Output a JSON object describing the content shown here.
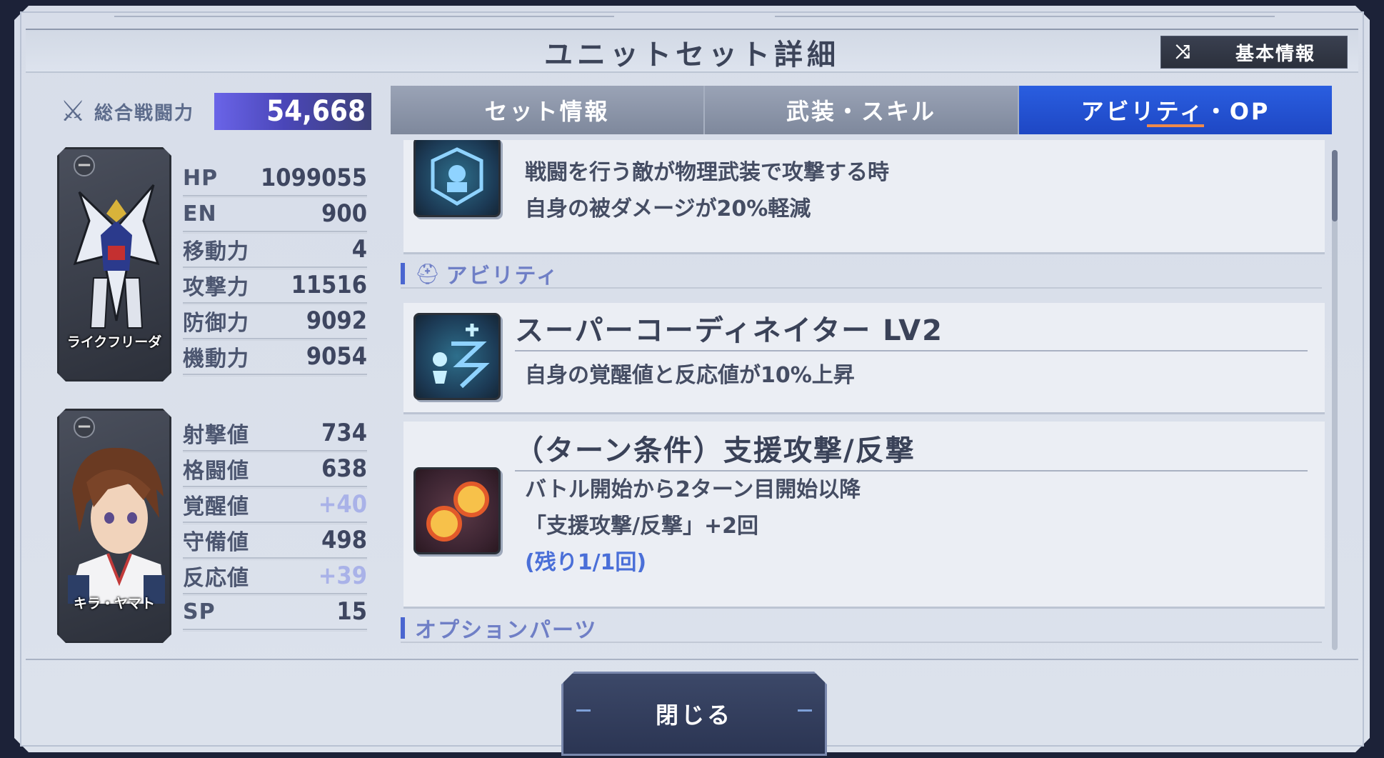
{
  "header": {
    "title": "ユニットセット詳細",
    "basic_info_label": "基本情報",
    "basic_info_icon": "shuffle-icon"
  },
  "power": {
    "label": "総合戦闘力",
    "value": "54,668",
    "icon": "crossed-swords-icon"
  },
  "unit_card": {
    "caption": "ライクフリーダ"
  },
  "pilot_card": {
    "caption": "キラ・ヤマト"
  },
  "unit_stats": [
    {
      "label": "HP",
      "value": "1099055"
    },
    {
      "label": "EN",
      "value": "900"
    },
    {
      "label": "移動力",
      "value": "4"
    },
    {
      "label": "攻撃力",
      "value": "11516"
    },
    {
      "label": "防御力",
      "value": "9092"
    },
    {
      "label": "機動力",
      "value": "9054"
    }
  ],
  "pilot_stats": [
    {
      "label": "射撃値",
      "value": "734"
    },
    {
      "label": "格闘値",
      "value": "638"
    },
    {
      "label": "覚醒値",
      "value": "+40"
    },
    {
      "label": "守備値",
      "value": "498"
    },
    {
      "label": "反応値",
      "value": "+39"
    },
    {
      "label": "SP",
      "value": "15"
    }
  ],
  "tabs": [
    {
      "label": "セット情報",
      "active": false
    },
    {
      "label": "武装・スキル",
      "active": false
    },
    {
      "label": "アビリティ・OP",
      "active": true
    }
  ],
  "content": {
    "partial_item": {
      "line1": "戦闘を行う敵が物理武装で攻撃する時",
      "line2": "自身の被ダメージが20%軽減"
    },
    "ability_section_label": "アビリティ",
    "ability1": {
      "title": "スーパーコーディネイター LV2",
      "desc": "自身の覚醒値と反応値が10%上昇"
    },
    "ability2": {
      "title": "（ターン条件）支援攻撃/反撃",
      "line1": "バトル開始から2ターン目開始以降",
      "line2": "「支援攻撃/反撃」+2回",
      "remaining": "(残り1/1回)"
    },
    "option_section_label": "オプションパーツ"
  },
  "footer": {
    "close_label": "閉じる"
  },
  "colors": {
    "active_tab": "#1e47c4",
    "power_bar": "#4a46b8",
    "accent_blue": "#4a6fd8"
  }
}
